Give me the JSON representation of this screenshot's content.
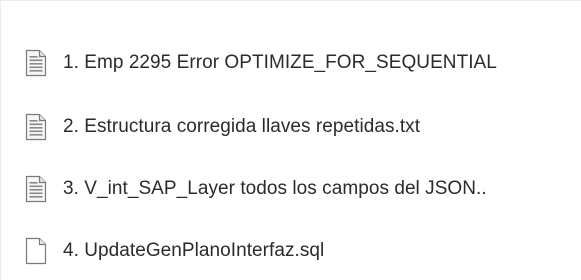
{
  "recent_files": {
    "items": [
      {
        "label": "1. Emp 2295 Error OPTIMIZE_FOR_SEQUENTIAL",
        "icon": "text-document-icon"
      },
      {
        "label": "2. Estructura corregida llaves repetidas.txt",
        "icon": "text-document-icon"
      },
      {
        "label": "3. V_int_SAP_Layer todos los campos del JSON..",
        "icon": "text-document-icon"
      },
      {
        "label": "4. UpdateGenPlanoInterfaz.sql",
        "icon": "blank-document-icon"
      }
    ]
  },
  "colors": {
    "text": "#2b2b2b",
    "icon_outline": "#7a7a7a",
    "icon_lines": "#8a8a8a",
    "background": "#ffffff"
  }
}
